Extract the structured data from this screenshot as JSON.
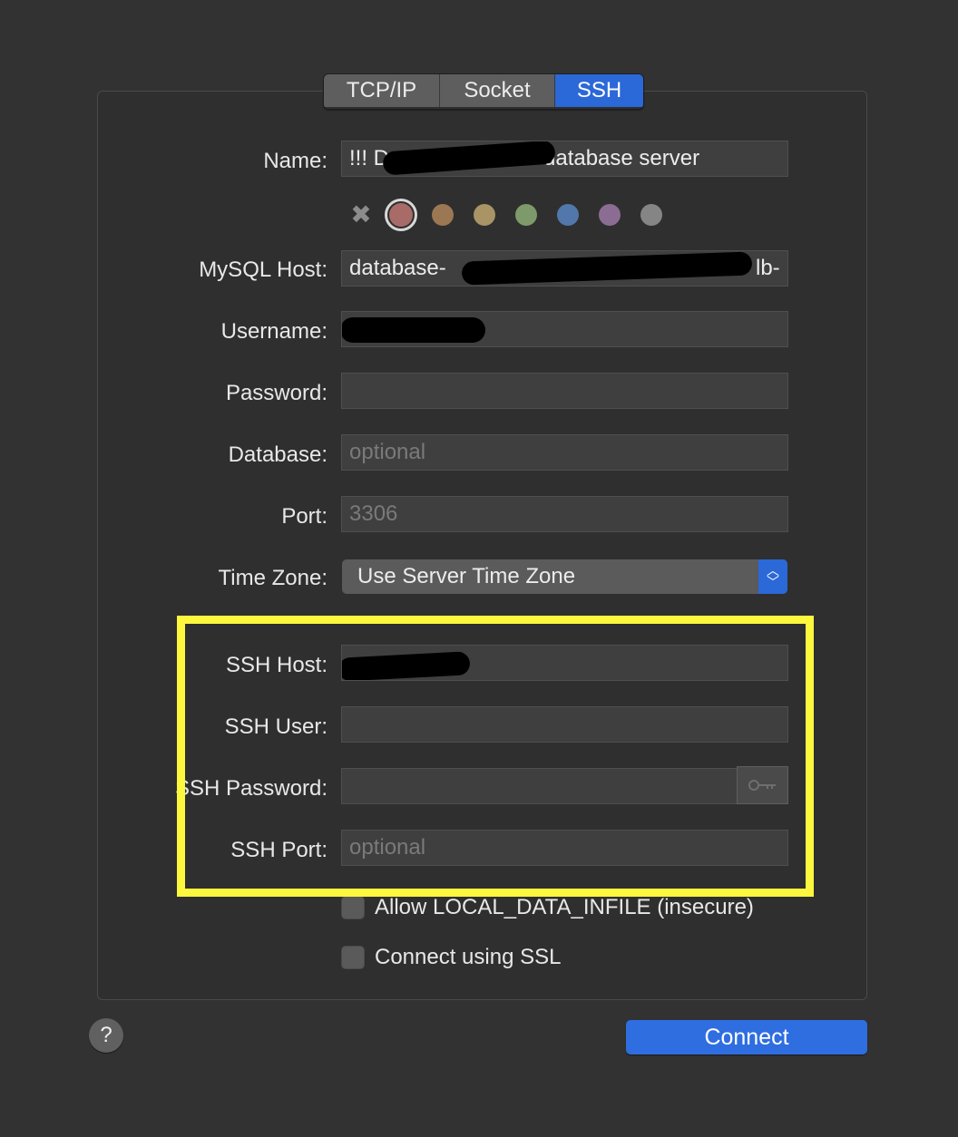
{
  "tabs": [
    {
      "label": "TCP/IP"
    },
    {
      "label": "Socket"
    },
    {
      "label": "SSH",
      "selected": true
    }
  ],
  "form": {
    "name_label": "Name:",
    "name_value": "!!! D",
    "name_value_end": "database server",
    "colors": {
      "clear_icon": "x-icon",
      "swatches": [
        "#a86b67",
        "#9c7753",
        "#a89464",
        "#7e9a6a",
        "#5277aa",
        "#8b6c93",
        "#858585"
      ],
      "selected_index": 0
    },
    "mysql_host_label": "MySQL Host:",
    "mysql_host_value": "database-",
    "mysql_host_value_end": "lb-",
    "username_label": "Username:",
    "password_label": "Password:",
    "database_label": "Database:",
    "database_placeholder": "optional",
    "port_label": "Port:",
    "port_placeholder": "3306",
    "timezone_label": "Time Zone:",
    "timezone_value": "Use Server Time Zone",
    "ssh_host_label": "SSH Host:",
    "ssh_user_label": "SSH User:",
    "ssh_password_label": "SSH Password:",
    "ssh_port_label": "SSH Port:",
    "ssh_port_placeholder": "optional",
    "allow_local_label": "Allow LOCAL_DATA_INFILE (insecure)",
    "ssl_label": "Connect using SSL"
  },
  "footer": {
    "help_label": "?",
    "connect_label": "Connect"
  },
  "colors": {
    "accent": "#2b68d8",
    "highlight": "#fdf73d",
    "background": "#323232"
  }
}
